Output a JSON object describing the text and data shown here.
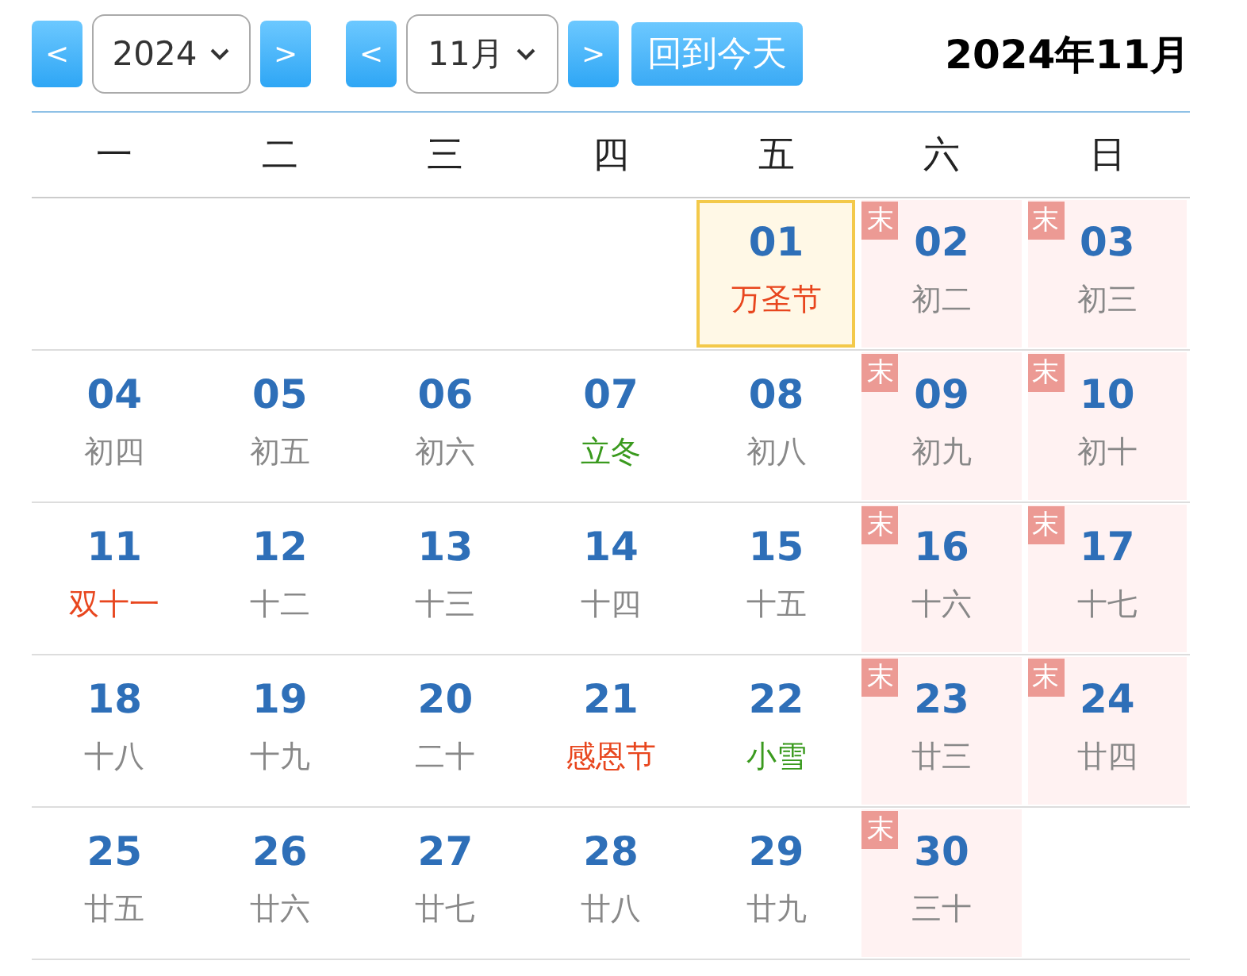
{
  "toolbar": {
    "year_prev": "<",
    "year": "2024",
    "year_next": ">",
    "month_prev": "<",
    "month": "11月",
    "month_next": ">",
    "today_button": "回到今天",
    "title": "2024年11月"
  },
  "weekdays": [
    "一",
    "二",
    "三",
    "四",
    "五",
    "六",
    "日"
  ],
  "weeks": [
    [
      {
        "kind": "empty"
      },
      {
        "kind": "empty"
      },
      {
        "kind": "empty"
      },
      {
        "kind": "empty"
      },
      {
        "kind": "festival",
        "day": "01",
        "sub": "万圣节",
        "today": true
      },
      {
        "kind": "lunar",
        "day": "02",
        "sub": "初二",
        "badge": "末",
        "today": false
      },
      {
        "kind": "lunar",
        "day": "03",
        "sub": "初三",
        "badge": "末",
        "today": false
      }
    ],
    [
      {
        "kind": "lunar",
        "day": "04",
        "sub": "初四",
        "today": false
      },
      {
        "kind": "lunar",
        "day": "05",
        "sub": "初五",
        "today": false
      },
      {
        "kind": "lunar",
        "day": "06",
        "sub": "初六",
        "today": false
      },
      {
        "kind": "solar",
        "day": "07",
        "sub": "立冬",
        "today": false
      },
      {
        "kind": "lunar",
        "day": "08",
        "sub": "初八",
        "today": false
      },
      {
        "kind": "lunar",
        "day": "09",
        "sub": "初九",
        "badge": "末",
        "today": false
      },
      {
        "kind": "lunar",
        "day": "10",
        "sub": "初十",
        "badge": "末",
        "today": false
      }
    ],
    [
      {
        "kind": "festival",
        "day": "11",
        "sub": "双十一",
        "today": false
      },
      {
        "kind": "lunar",
        "day": "12",
        "sub": "十二",
        "today": false
      },
      {
        "kind": "lunar",
        "day": "13",
        "sub": "十三",
        "today": false
      },
      {
        "kind": "lunar",
        "day": "14",
        "sub": "十四",
        "today": false
      },
      {
        "kind": "lunar",
        "day": "15",
        "sub": "十五",
        "today": false
      },
      {
        "kind": "lunar",
        "day": "16",
        "sub": "十六",
        "badge": "末",
        "today": false
      },
      {
        "kind": "lunar",
        "day": "17",
        "sub": "十七",
        "badge": "末",
        "today": false
      }
    ],
    [
      {
        "kind": "lunar",
        "day": "18",
        "sub": "十八",
        "today": false
      },
      {
        "kind": "lunar",
        "day": "19",
        "sub": "十九",
        "today": false
      },
      {
        "kind": "lunar",
        "day": "20",
        "sub": "二十",
        "today": false
      },
      {
        "kind": "festival",
        "day": "21",
        "sub": "感恩节",
        "today": false
      },
      {
        "kind": "solar",
        "day": "22",
        "sub": "小雪",
        "today": false
      },
      {
        "kind": "lunar",
        "day": "23",
        "sub": "廿三",
        "badge": "末",
        "today": false
      },
      {
        "kind": "lunar",
        "day": "24",
        "sub": "廿四",
        "badge": "末",
        "today": false
      }
    ],
    [
      {
        "kind": "lunar",
        "day": "25",
        "sub": "廿五",
        "today": false
      },
      {
        "kind": "lunar",
        "day": "26",
        "sub": "廿六",
        "today": false
      },
      {
        "kind": "lunar",
        "day": "27",
        "sub": "廿七",
        "today": false
      },
      {
        "kind": "lunar",
        "day": "28",
        "sub": "廿八",
        "today": false
      },
      {
        "kind": "lunar",
        "day": "29",
        "sub": "廿九",
        "today": false
      },
      {
        "kind": "lunar",
        "day": "30",
        "sub": "三十",
        "badge": "末",
        "today": false
      },
      {
        "kind": "empty"
      }
    ]
  ]
}
